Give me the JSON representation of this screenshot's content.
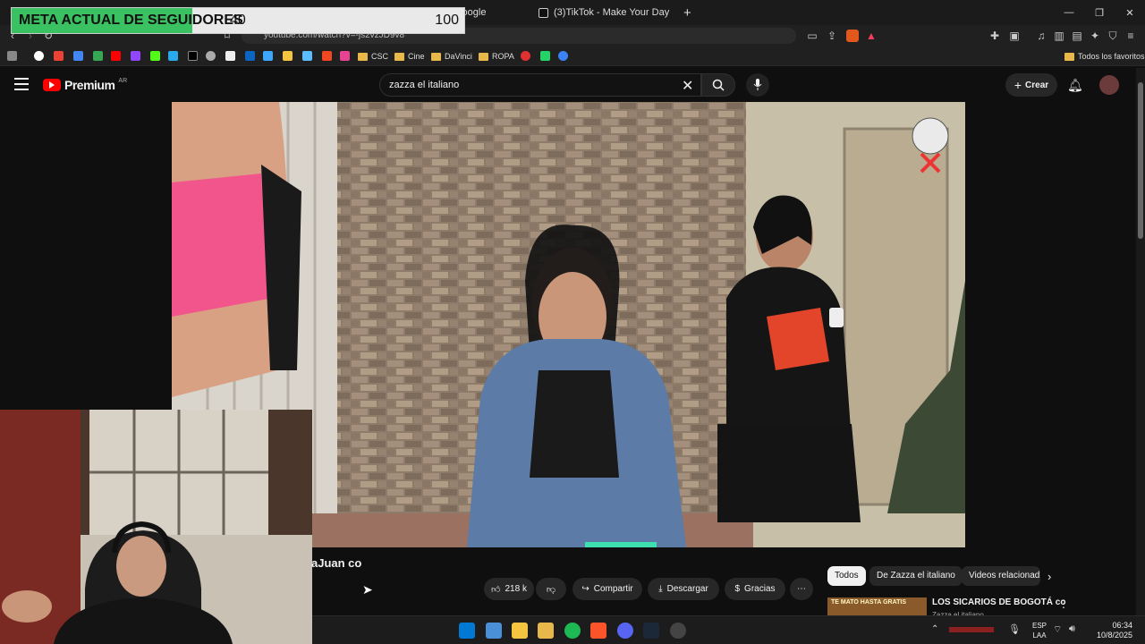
{
  "overlay": {
    "goal_label": "META ACTUAL DE SEGUIDORES",
    "current": "40",
    "target": "100",
    "progress": 0.4
  },
  "browser": {
    "tabs": [
      {
        "label": "Google"
      },
      {
        "label": "(3)TikTok - Make Your Day"
      }
    ],
    "url": "youtube.com/watch?v=-js2vzJD9v8",
    "bookmarks_folders": [
      "CSC",
      "Cine",
      "DaVinci",
      "ROPA"
    ],
    "all_bookmarks_label": "Todos los favoritos"
  },
  "youtube": {
    "brand": "Premium",
    "country": "AR",
    "search_query": "zazza el italiano",
    "create_label": "Crear",
    "video_title_fragment": "aJuan co",
    "actions": {
      "likes": "218 k",
      "share": "Compartir",
      "download": "Descargar",
      "thanks": "Gracias"
    },
    "chips": [
      "Todos",
      "De Zazza el italiano",
      "Videos relacionad"
    ],
    "suggested": {
      "title": "LOS SICARIOS DE BOGOTÁ co",
      "channel": "Zazza el italiano",
      "thumb_text": "TE MATO HASTA GRATIS"
    }
  },
  "taskbar": {
    "lang_top": "ESP",
    "lang_bottom": "LAA",
    "time": "06:34",
    "date": "10/8/2025"
  }
}
